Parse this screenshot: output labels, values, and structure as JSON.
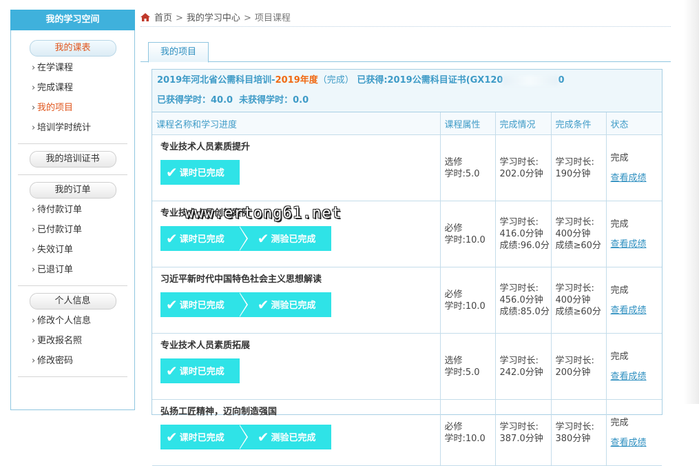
{
  "sidebar": {
    "title": "我的学习空间",
    "groups": [
      {
        "pill": "我的课表",
        "items": [
          "在学课程",
          "完成课程",
          "我的项目",
          "培训学时统计"
        ]
      },
      {
        "pill": "我的培训证书",
        "items": []
      },
      {
        "pill": "我的订单",
        "items": [
          "待付款订单",
          "已付款订单",
          "失效订单",
          "已退订单"
        ]
      },
      {
        "pill": "个人信息",
        "items": [
          "修改个人信息",
          "更改报名照",
          "修改密码"
        ]
      }
    ]
  },
  "breadcrumb": {
    "home": "首页",
    "sep": ">",
    "center": "我的学习中心",
    "current": "项目课程"
  },
  "tab": {
    "label": "我的项目"
  },
  "project": {
    "title_part1": "2019年河北省公需科目培训-",
    "title_year": "2019年度",
    "title_status": "（完成）",
    "cert_text": "已获得:2019公需科目证书(GX120",
    "cert_tail": "0",
    "earned_hours": "已获得学时：40.0",
    "unearned_hours": "未获得学时：0.0"
  },
  "table": {
    "headers": [
      "课程名称和学习进度",
      "课程属性",
      "完成情况",
      "完成条件",
      "状态"
    ],
    "rows": [
      {
        "name": "专业技术人员素质提升",
        "badges": [
          "课时已完成"
        ],
        "attr1": "选修",
        "attr2": "学时:5.0",
        "done": [
          "学习时长:",
          "202.0分钟"
        ],
        "cond": [
          "学习时长:",
          "190分钟"
        ],
        "status": "完成",
        "link": "查看成绩"
      },
      {
        "name": "专业技术人员创新案例",
        "badges": [
          "课时已完成",
          "测验已完成"
        ],
        "attr1": "必修",
        "attr2": "学时:10.0",
        "done": [
          "学习时长:",
          "416.0分钟",
          "成绩:96.0分"
        ],
        "cond": [
          "学习时长:",
          "400分钟",
          "成绩≥60分"
        ],
        "status": "完成",
        "link": "查看成绩"
      },
      {
        "name": "习近平新时代中国特色社会主义思想解读",
        "badges": [
          "课时已完成",
          "测验已完成"
        ],
        "attr1": "必修",
        "attr2": "学时:10.0",
        "done": [
          "学习时长:",
          "456.0分钟",
          "成绩:85.0分"
        ],
        "cond": [
          "学习时长:",
          "400分钟",
          "成绩≥60分"
        ],
        "status": "完成",
        "link": "查看成绩"
      },
      {
        "name": "专业技术人员素质拓展",
        "badges": [
          "课时已完成"
        ],
        "attr1": "选修",
        "attr2": "学时:5.0",
        "done": [
          "学习时长:",
          "242.0分钟"
        ],
        "cond": [
          "学习时长:",
          "200分钟"
        ],
        "status": "完成",
        "link": "查看成绩"
      },
      {
        "name": "弘扬工匠精神，迈向制造强国",
        "badges": [
          "课时已完成",
          "测验已完成"
        ],
        "attr1": "必修",
        "attr2": "学时:10.0",
        "done": [
          "学习时长:",
          "387.0分钟"
        ],
        "cond": [
          "学习时长:",
          "380分钟"
        ],
        "status": "完成",
        "link": "查看成绩"
      }
    ]
  },
  "watermark": "www.ertong61.net",
  "colors": {
    "accent": "#3fb1dc",
    "badge": "#2fe3e7",
    "highlight": "#f06a14",
    "link": "#2e8fc0"
  }
}
